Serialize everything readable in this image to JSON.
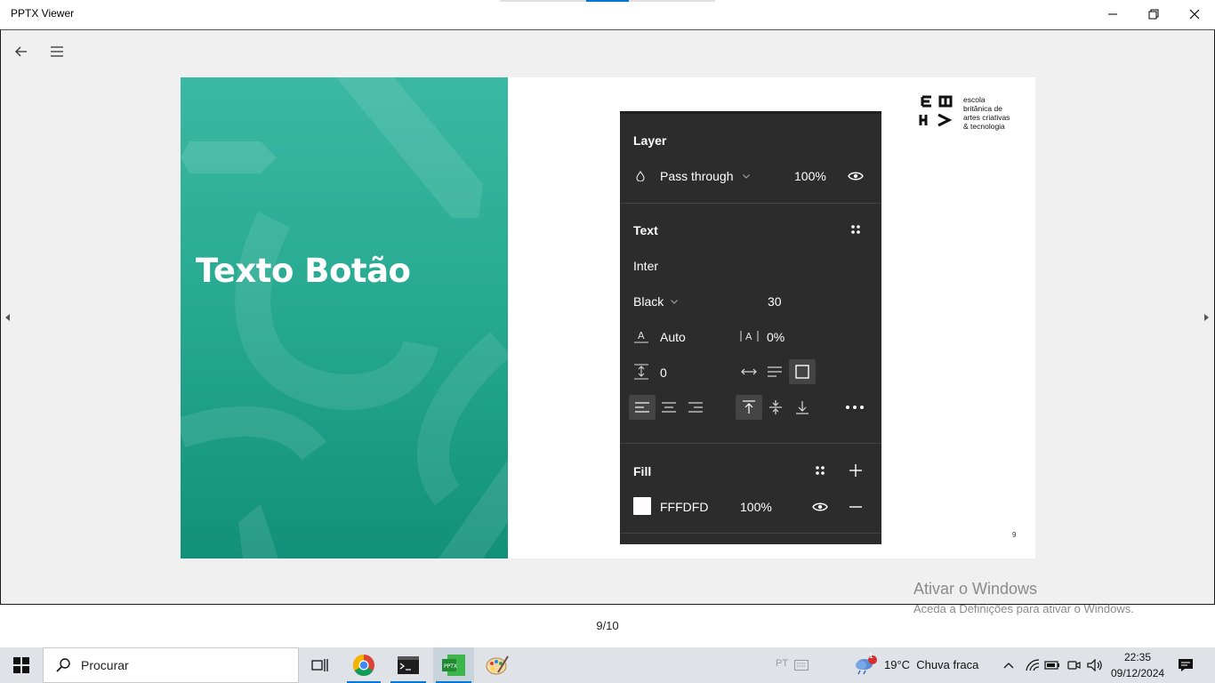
{
  "window": {
    "title": "PPTX Viewer",
    "minimize_icon": "minimize-icon",
    "maximize_icon": "restore-icon",
    "close_icon": "close-icon"
  },
  "toolbar": {
    "back_icon": "back-arrow-icon",
    "menu_icon": "hamburger-menu-icon"
  },
  "slide": {
    "title": "Texto Botão",
    "number": "9",
    "logo_lines": [
      "escola",
      "britânica de",
      "artes criativas",
      "& tecnologia"
    ],
    "panel": {
      "layer": {
        "heading": "Layer",
        "blend_mode": "Pass through",
        "opacity": "100%"
      },
      "text": {
        "heading": "Text",
        "font_family": "Inter",
        "font_weight": "Black",
        "font_size": "30",
        "line_height": "Auto",
        "letter_spacing": "0%",
        "paragraph_spacing": "0"
      },
      "fill": {
        "heading": "Fill",
        "hex": "FFFDFD",
        "opacity": "100%",
        "swatch_color": "#FFFDFD"
      }
    }
  },
  "pager": {
    "label": "9/10"
  },
  "watermark": {
    "line1": "Ativar o Windows",
    "line2": "Aceda a Definições para ativar o Windows."
  },
  "taskbar": {
    "search_placeholder": "Procurar",
    "weather": "19°C  Chuva fraca",
    "weather_badge": "1",
    "language": "PT",
    "time": "22:35",
    "date": "09/12/2024"
  },
  "colors": {
    "accent": "#0078d7",
    "slide_teal": "#26a88f",
    "panel_bg": "#2c2c2c"
  }
}
